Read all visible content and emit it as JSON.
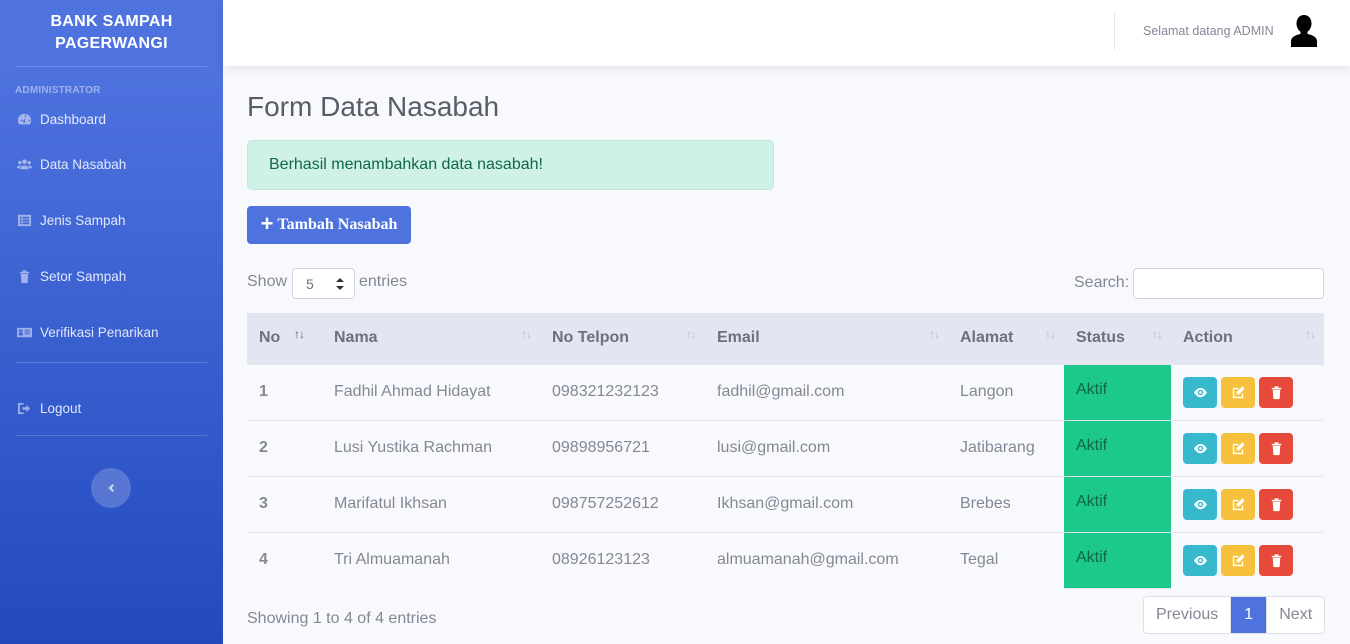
{
  "sidebar": {
    "brand_line1": "BANK SAMPAH",
    "brand_line2": "PAGERWANGI",
    "heading": "ADMINISTRATOR",
    "items": [
      {
        "label": "Dashboard",
        "icon": "tachometer-icon"
      },
      {
        "label": "Data Nasabah",
        "icon": "users-icon"
      },
      {
        "label": "Jenis Sampah",
        "icon": "list-icon"
      },
      {
        "label": "Setor Sampah",
        "icon": "trash-icon"
      },
      {
        "label": "Verifikasi Penarikan",
        "icon": "id-card-icon"
      }
    ],
    "logout_label": "Logout",
    "toggle_icon": "chevron-left-icon"
  },
  "topbar": {
    "welcome": "Selamat datang ADMIN",
    "avatar_icon": "user-icon"
  },
  "main": {
    "title": "Form Data Nasabah",
    "alert": "Berhasil menambahkan data nasabah!",
    "add_button": "Tambah Nasabah",
    "show_label": "Show",
    "entries_value": "5",
    "entries_label": "entries",
    "search_label": "Search:",
    "search_value": ""
  },
  "table": {
    "headers": [
      "No",
      "Nama",
      "No Telpon",
      "Email",
      "Alamat",
      "Status",
      "Action"
    ],
    "rows": [
      {
        "no": "1",
        "nama": "Fadhil Ahmad Hidayat",
        "telpon": "098321232123",
        "email": "fadhil@gmail.com",
        "alamat": "Langon",
        "status": "Aktif"
      },
      {
        "no": "2",
        "nama": "Lusi Yustika Rachman",
        "telpon": "09898956721",
        "email": "lusi@gmail.com",
        "alamat": "Jatibarang",
        "status": "Aktif"
      },
      {
        "no": "3",
        "nama": "Marifatul Ikhsan",
        "telpon": "098757252612",
        "email": "Ikhsan@gmail.com",
        "alamat": "Brebes",
        "status": "Aktif"
      },
      {
        "no": "4",
        "nama": "Tri Almuamanah",
        "telpon": "08926123123",
        "email": "almuamanah@gmail.com",
        "alamat": "Tegal",
        "status": "Aktif"
      }
    ]
  },
  "footer": {
    "showing": "Showing 1 to 4 of 4 entries",
    "previous": "Previous",
    "page": "1",
    "next": "Next"
  },
  "colors": {
    "primary": "#4e73df",
    "success": "#1cc88a",
    "info": "#36b9cc",
    "warning": "#f6c23e",
    "danger": "#e74a3b"
  }
}
